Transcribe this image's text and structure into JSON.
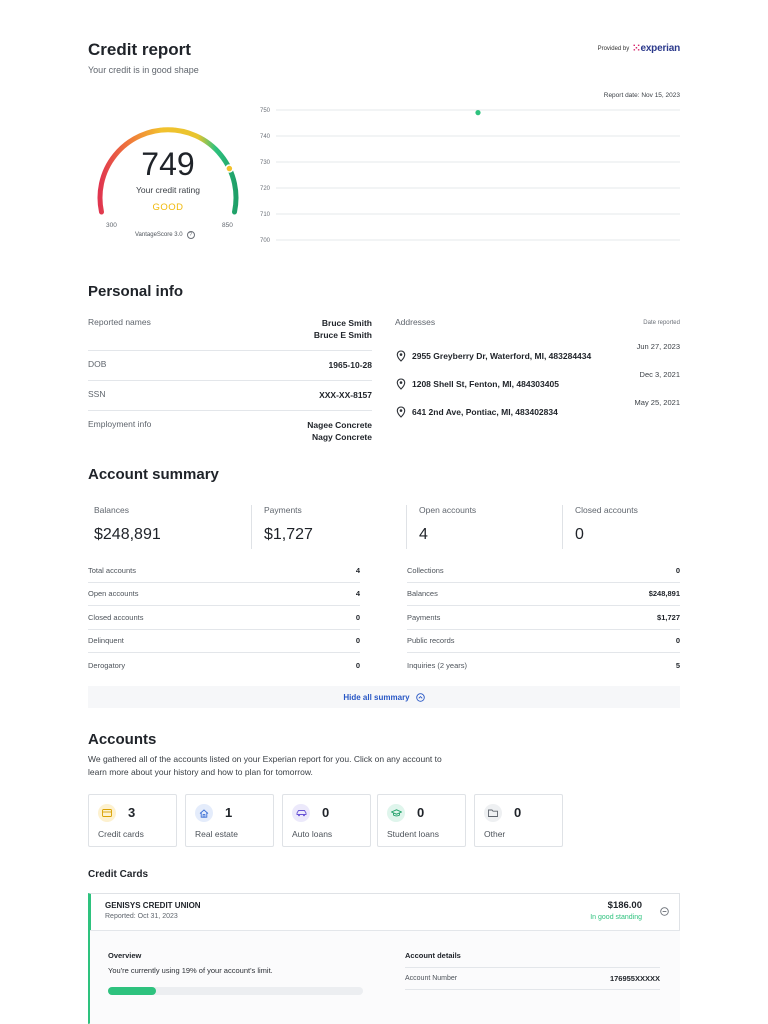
{
  "header": {
    "title": "Credit report",
    "subtitle": "Your credit is in good shape",
    "provided_by": "Provided by",
    "provider": "experian",
    "report_date": "Report date: Nov 15, 2023"
  },
  "score": {
    "value": "749",
    "label": "Your credit rating",
    "rating": "GOOD",
    "min": "300",
    "max": "850",
    "model": "VantageScore 3.0",
    "level_fraction": 0.816,
    "colors": {
      "good": "#f0b90b",
      "green": "#2ec27e",
      "red": "#e0364f"
    }
  },
  "chart_data": {
    "type": "scatter",
    "title": "",
    "xlabel": "",
    "ylabel": "",
    "ylim": [
      700,
      750
    ],
    "y_ticks": [
      "750",
      "740",
      "730",
      "720",
      "710",
      "700"
    ],
    "grid": true,
    "series": [
      {
        "values": [
          749
        ]
      }
    ],
    "x_fraction_of_point": 0.5
  },
  "personal_info": {
    "title": "Personal info",
    "rows": [
      {
        "label": "Reported names",
        "values": [
          "Bruce Smith",
          "Bruce E Smith"
        ]
      },
      {
        "label": "DOB",
        "values": [
          "1965-10-28"
        ]
      },
      {
        "label": "SSN",
        "values": [
          "XXX-XX-8157"
        ]
      },
      {
        "label": "Employment info",
        "values": [
          "Nagee Concrete",
          "Nagy Concrete"
        ]
      }
    ],
    "addresses_label": "Addresses",
    "date_reported_label": "Date reported",
    "addresses": [
      {
        "address": "2955 Greyberry Dr, Waterford, MI, 483284434",
        "date": "Jun 27, 2023"
      },
      {
        "address": "1208 Shell St, Fenton, MI, 484303405",
        "date": "Dec 3, 2021"
      },
      {
        "address": "641 2nd Ave, Pontiac, MI, 483402834",
        "date": "May 25, 2021"
      }
    ]
  },
  "account_summary": {
    "title": "Account summary",
    "stats": [
      {
        "label": "Balances",
        "value": "$248,891"
      },
      {
        "label": "Payments",
        "value": "$1,727"
      },
      {
        "label": "Open accounts",
        "value": "4"
      },
      {
        "label": "Closed accounts",
        "value": "0"
      }
    ],
    "left_rows": [
      {
        "label": "Total accounts",
        "value": "4"
      },
      {
        "label": "Open accounts",
        "value": "4"
      },
      {
        "label": "Closed accounts",
        "value": "0"
      },
      {
        "label": "Delinquent",
        "value": "0"
      },
      {
        "label": "Derogatory",
        "value": "0"
      }
    ],
    "right_rows": [
      {
        "label": "Collections",
        "value": "0"
      },
      {
        "label": "Balances",
        "value": "$248,891"
      },
      {
        "label": "Payments",
        "value": "$1,727"
      },
      {
        "label": "Public records",
        "value": "0"
      },
      {
        "label": "Inquiries (2 years)",
        "value": "5"
      }
    ],
    "hide_label": "Hide all summary"
  },
  "accounts": {
    "title": "Accounts",
    "description": "We gathered all of the accounts listed on your Experian report for you. Click on any account to learn more about your history and how to plan for tomorrow.",
    "types": [
      {
        "count": "3",
        "label": "Credit cards",
        "icon": "credit-card-icon",
        "color": "#fdf1cf"
      },
      {
        "count": "1",
        "label": "Real estate",
        "icon": "house-icon",
        "color": "#e4ecfb"
      },
      {
        "count": "0",
        "label": "Auto loans",
        "icon": "car-icon",
        "color": "#ece9fb"
      },
      {
        "count": "0",
        "label": "Student loans",
        "icon": "graduation-cap-icon",
        "color": "#dff5ec"
      },
      {
        "count": "0",
        "label": "Other",
        "icon": "folder-icon",
        "color": "#eef0f2"
      }
    ]
  },
  "credit_cards": {
    "title": "Credit Cards",
    "item": {
      "name": "GENISYS CREDIT UNION",
      "reported": "Reported: Oct 31, 2023",
      "amount": "$186.00",
      "status": "In good standing",
      "overview_label": "Overview",
      "overview_text": "You're currently using 19% of your account's limit.",
      "usage_fraction": 0.19,
      "details_label": "Account details",
      "account_number_label": "Account Number",
      "account_number": "176955XXXXX"
    }
  }
}
